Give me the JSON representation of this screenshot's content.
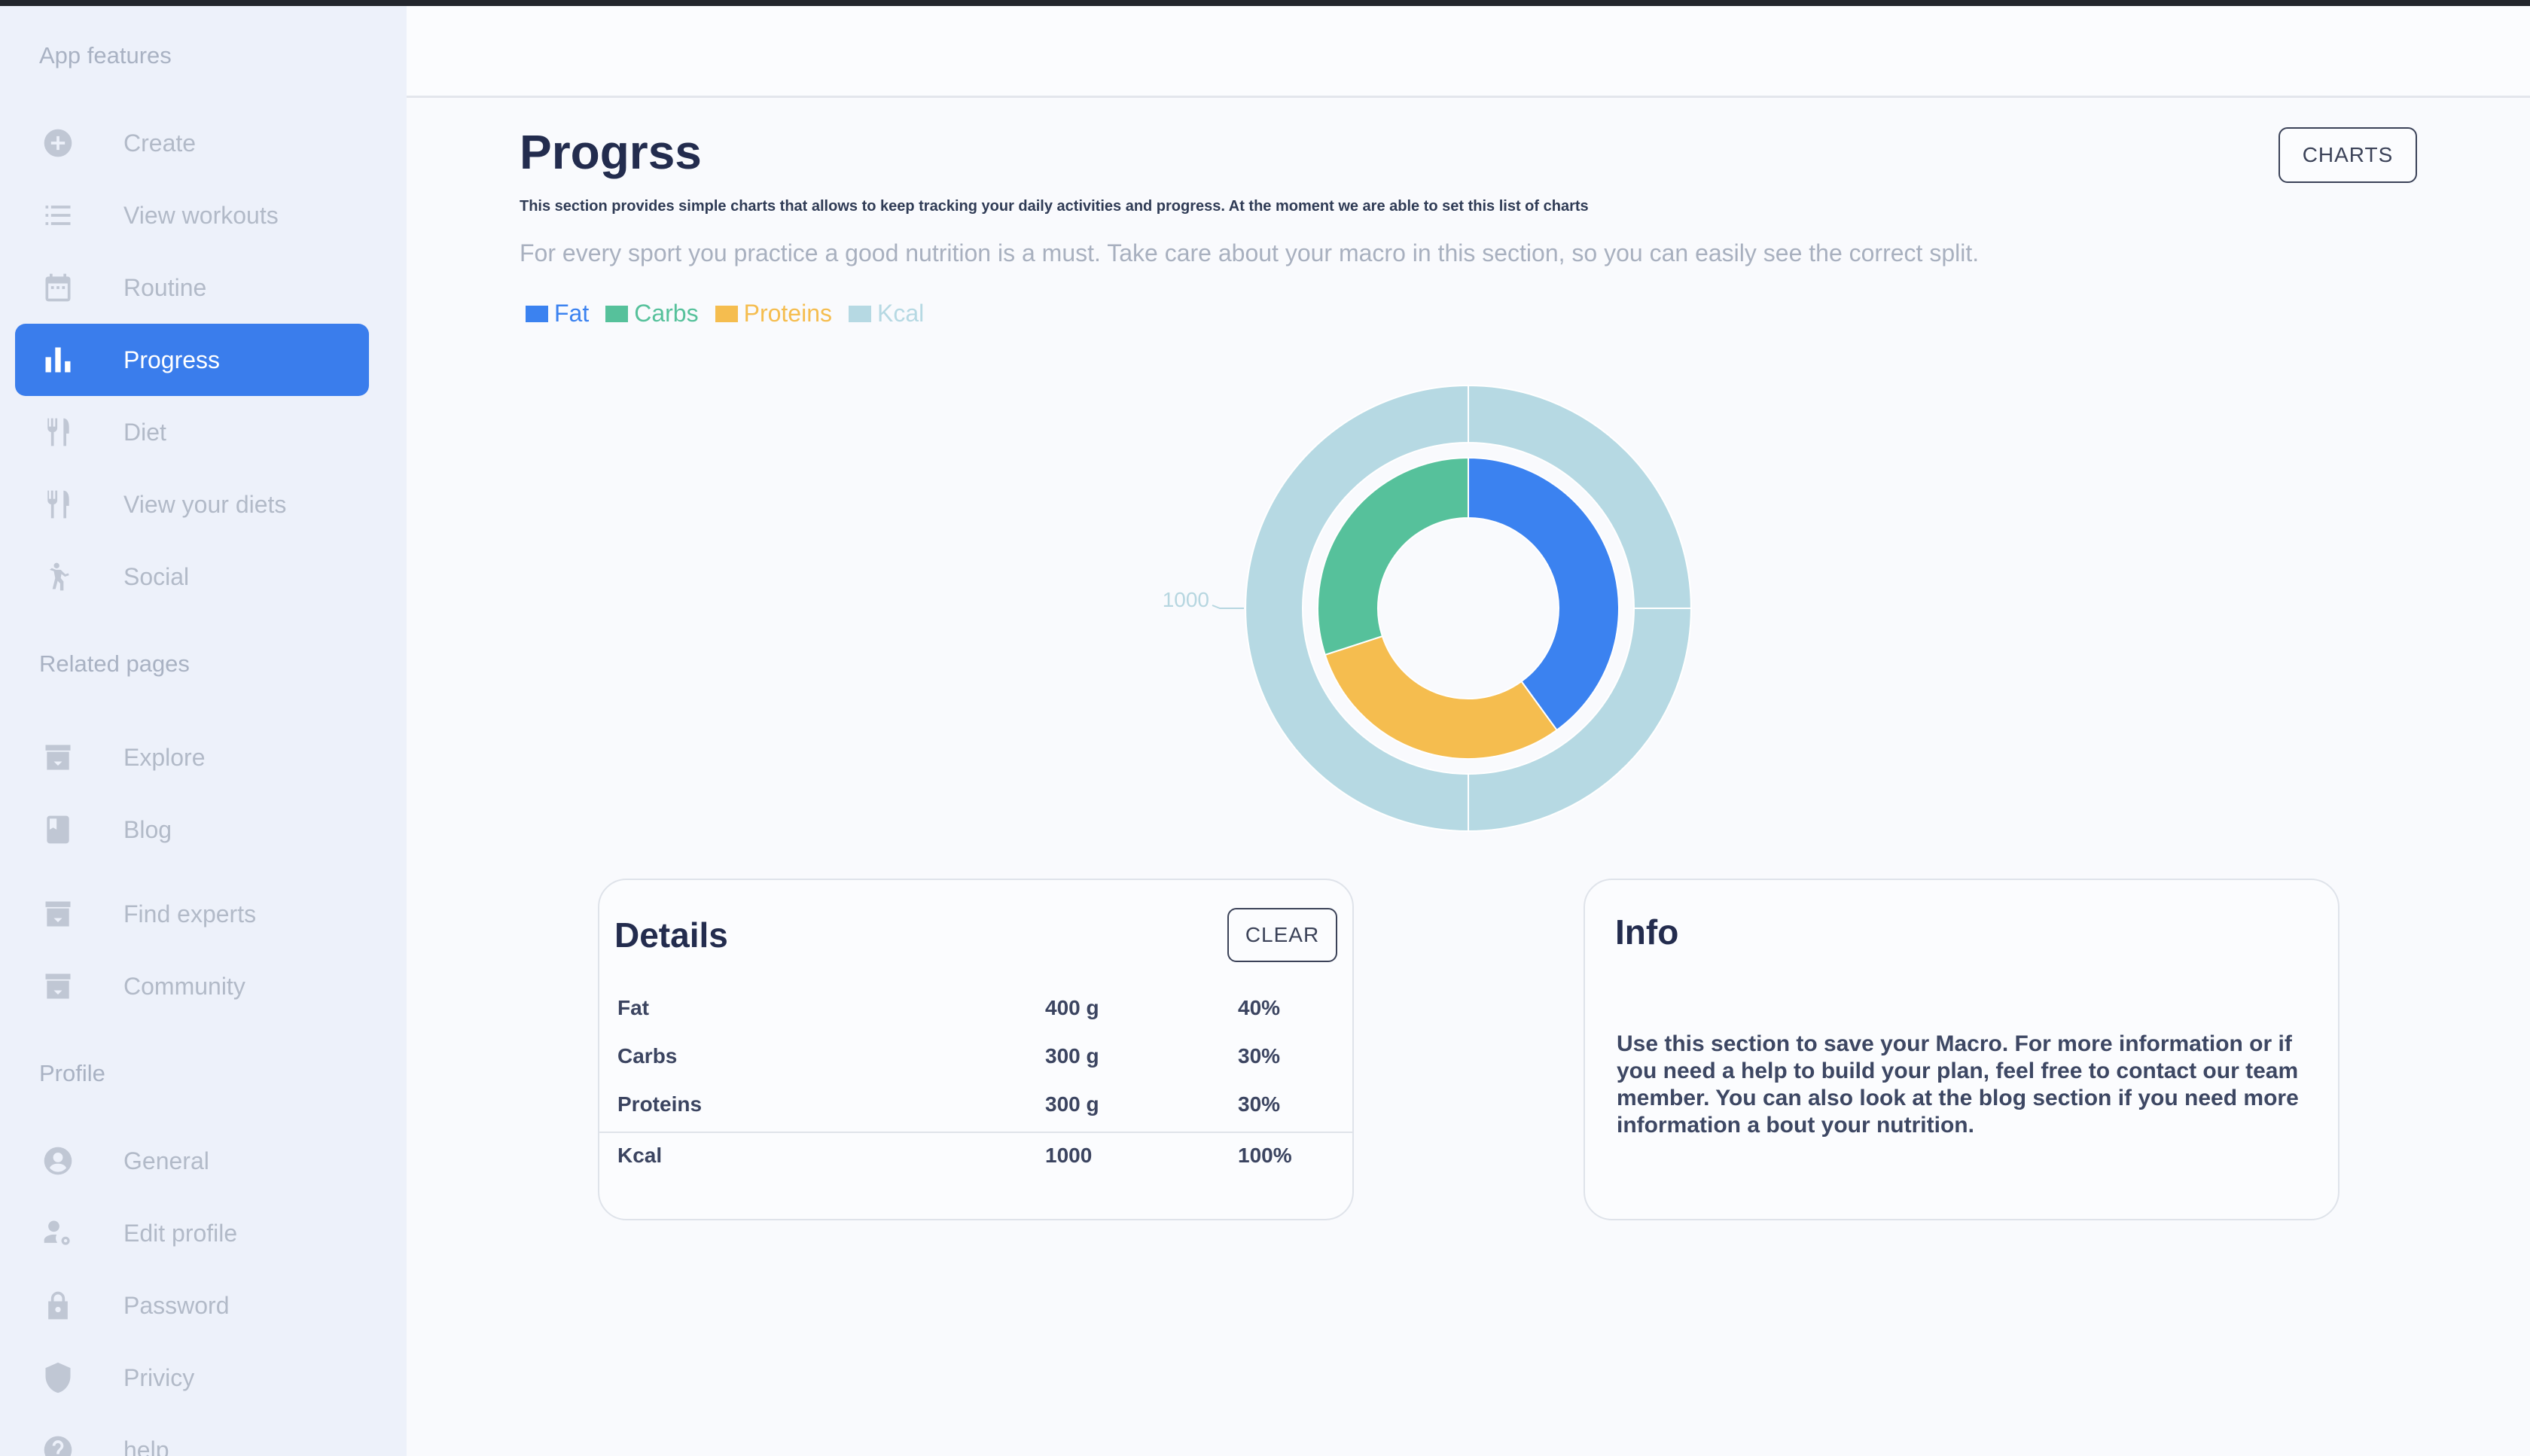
{
  "sidebar": {
    "sections": [
      {
        "label": "App features"
      },
      {
        "label": "Related pages"
      },
      {
        "label": "Profile"
      }
    ],
    "items": [
      {
        "label": "Create",
        "icon": "plus-circle-icon"
      },
      {
        "label": "View workouts",
        "icon": "list-icon"
      },
      {
        "label": "Routine",
        "icon": "calendar-icon"
      },
      {
        "label": "Progress",
        "icon": "bar-chart-icon",
        "active": true
      },
      {
        "label": "Diet",
        "icon": "fork-knife-icon"
      },
      {
        "label": "View your diets",
        "icon": "fork-knife-icon"
      },
      {
        "label": "Social",
        "icon": "person-activity-icon"
      },
      {
        "label": "Explore",
        "icon": "archive-icon"
      },
      {
        "label": "Blog",
        "icon": "book-icon"
      },
      {
        "label": "Find experts",
        "icon": "archive-icon"
      },
      {
        "label": "Community",
        "icon": "archive-icon"
      },
      {
        "label": "General",
        "icon": "account-circle-icon"
      },
      {
        "label": "Edit profile",
        "icon": "user-settings-icon"
      },
      {
        "label": "Password",
        "icon": "lock-icon"
      },
      {
        "label": "Privicy",
        "icon": "shield-icon"
      },
      {
        "label": "help",
        "icon": "help-circle-icon"
      }
    ]
  },
  "main": {
    "title": "Progrss",
    "charts_button": "CHARTS",
    "subtitle": "This section provides simple charts that allows to keep tracking your daily activities and progress. At the moment we are able to set this list of charts",
    "description": "For every sport you practice a good nutrition is a must. Take care about your macro in this section, so you can easily see the correct split."
  },
  "colors": {
    "accent": "#3a7dec",
    "fat": "#3b82f0",
    "carbs": "#56c19b",
    "proteins": "#f5bd4f",
    "kcal": "#b6d9e3"
  },
  "chart_data": {
    "type": "pie",
    "legend": [
      {
        "name": "Fat",
        "color": "#3b82f0"
      },
      {
        "name": "Carbs",
        "color": "#56c19b"
      },
      {
        "name": "Proteins",
        "color": "#f5bd4f"
      },
      {
        "name": "Kcal",
        "color": "#b6d9e3"
      }
    ],
    "inner_ring": [
      {
        "name": "Fat",
        "value": 400,
        "color": "#3b82f0"
      },
      {
        "name": "Proteins",
        "value": 300,
        "color": "#f5bd4f"
      },
      {
        "name": "Carbs",
        "value": 300,
        "color": "#56c19b"
      }
    ],
    "outer_ring": [
      {
        "name": "Kcal",
        "value": 1000,
        "color": "#b6d9e3"
      }
    ],
    "labels": [
      {
        "text": "1000"
      }
    ],
    "legend_position": "top-left"
  },
  "details": {
    "title": "Details",
    "clear_button": "CLEAR",
    "rows": [
      {
        "name": "Fat",
        "amount": "400 g",
        "percent": "40%"
      },
      {
        "name": "Carbs",
        "amount": "300 g",
        "percent": "30%"
      },
      {
        "name": "Proteins",
        "amount": "300 g",
        "percent": "30%"
      }
    ],
    "total": {
      "name": "Kcal",
      "amount": "1000",
      "percent": "100%"
    }
  },
  "info": {
    "title": "Info",
    "text": "Use this section to save your Macro. For more information or if you need a help to build your plan, feel free to contact our team member. You can also look at the blog section if you need more information a bout your nutrition."
  }
}
